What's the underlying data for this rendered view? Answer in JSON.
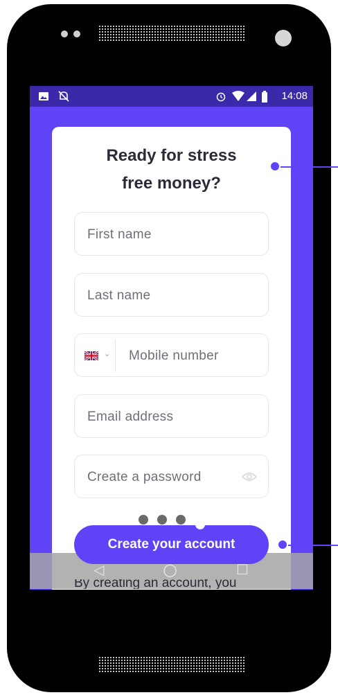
{
  "status_bar": {
    "time": "14:08"
  },
  "form": {
    "title_line1": "Ready for stress",
    "title_line2": "free money?",
    "first_name_placeholder": "First name",
    "last_name_placeholder": "Last name",
    "mobile_placeholder": "Mobile number",
    "email_placeholder": "Email address",
    "password_placeholder": "Create a password",
    "country_flag": "uk-flag-icon",
    "submit_label": "Create your account",
    "legal_text": "By creating an account, you"
  },
  "colors": {
    "brand": "#5f43f7",
    "status_bar": "#3a29a8",
    "text": "#2b2b3a",
    "placeholder": "#6f6f78"
  },
  "icons": [
    "image-icon",
    "notifications-off-icon",
    "alarm-icon",
    "wifi-icon",
    "signal-icon",
    "battery-icon",
    "uk-flag-icon",
    "chevron-down-icon",
    "eye-icon",
    "back-icon",
    "home-icon",
    "recents-icon"
  ]
}
